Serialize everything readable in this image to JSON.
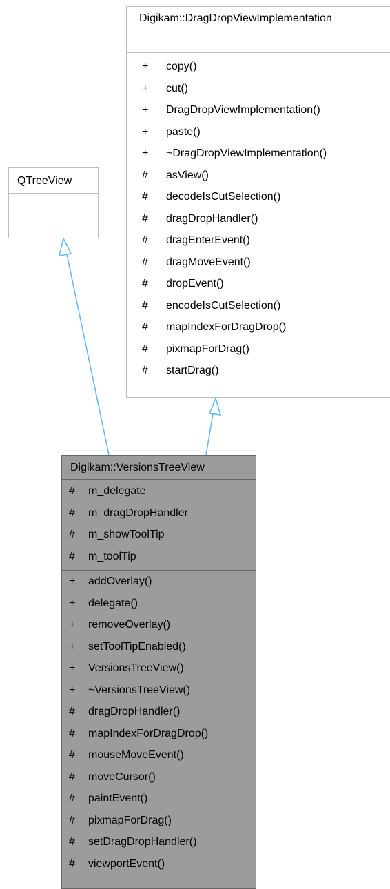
{
  "diagram": {
    "base_interface": {
      "title": "Digikam::DragDropViewImplementation",
      "attributes": [],
      "operations": [
        {
          "vis": "+",
          "name": "copy()"
        },
        {
          "vis": "+",
          "name": "cut()"
        },
        {
          "vis": "+",
          "name": "DragDropViewImplementation()"
        },
        {
          "vis": "+",
          "name": "paste()"
        },
        {
          "vis": "+",
          "name": "~DragDropViewImplementation()"
        },
        {
          "vis": "#",
          "name": "asView()"
        },
        {
          "vis": "#",
          "name": "decodeIsCutSelection()"
        },
        {
          "vis": "#",
          "name": "dragDropHandler()"
        },
        {
          "vis": "#",
          "name": "dragEnterEvent()"
        },
        {
          "vis": "#",
          "name": "dragMoveEvent()"
        },
        {
          "vis": "#",
          "name": "dropEvent()"
        },
        {
          "vis": "#",
          "name": "encodeIsCutSelection()"
        },
        {
          "vis": "#",
          "name": "mapIndexForDragDrop()"
        },
        {
          "vis": "#",
          "name": "pixmapForDrag()"
        },
        {
          "vis": "#",
          "name": "startDrag()"
        }
      ]
    },
    "base_qt": {
      "title": "QTreeView",
      "attributes": [],
      "operations": []
    },
    "derived": {
      "title": "Digikam::VersionsTreeView",
      "attributes": [
        {
          "vis": "#",
          "name": "m_delegate"
        },
        {
          "vis": "#",
          "name": "m_dragDropHandler"
        },
        {
          "vis": "#",
          "name": "m_showToolTip"
        },
        {
          "vis": "#",
          "name": "m_toolTip"
        }
      ],
      "operations": [
        {
          "vis": "+",
          "name": "addOverlay()"
        },
        {
          "vis": "+",
          "name": "delegate()"
        },
        {
          "vis": "+",
          "name": "removeOverlay()"
        },
        {
          "vis": "+",
          "name": "setToolTipEnabled()"
        },
        {
          "vis": "+",
          "name": "VersionsTreeView()"
        },
        {
          "vis": "+",
          "name": "~VersionsTreeView()"
        },
        {
          "vis": "#",
          "name": "dragDropHandler()"
        },
        {
          "vis": "#",
          "name": "mapIndexForDragDrop()"
        },
        {
          "vis": "#",
          "name": "mouseMoveEvent()"
        },
        {
          "vis": "#",
          "name": "moveCursor()"
        },
        {
          "vis": "#",
          "name": "paintEvent()"
        },
        {
          "vis": "#",
          "name": "pixmapForDrag()"
        },
        {
          "vis": "#",
          "name": "setDragDropHandler()"
        },
        {
          "vis": "#",
          "name": "viewportEvent()"
        }
      ]
    },
    "colors": {
      "edge": "#63b8ff",
      "box_border": "#bdbdbd",
      "highlight_fill": "#9c9c9c",
      "highlight_border": "#666666"
    }
  }
}
